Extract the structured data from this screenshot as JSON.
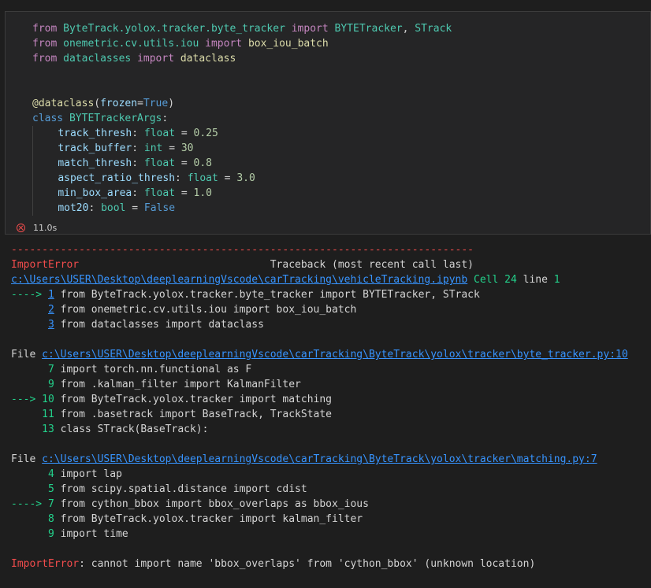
{
  "cell": {
    "code_lines": [
      [
        [
          "kw",
          "from"
        ],
        [
          "plain",
          " "
        ],
        [
          "mod",
          "ByteTrack.yolox.tracker.byte_tracker"
        ],
        [
          "plain",
          " "
        ],
        [
          "kw",
          "import"
        ],
        [
          "plain",
          " "
        ],
        [
          "cls",
          "BYTETracker"
        ],
        [
          "plain",
          ", "
        ],
        [
          "cls",
          "STrack"
        ]
      ],
      [
        [
          "kw",
          "from"
        ],
        [
          "plain",
          " "
        ],
        [
          "mod",
          "onemetric.cv.utils.iou"
        ],
        [
          "plain",
          " "
        ],
        [
          "kw",
          "import"
        ],
        [
          "plain",
          " "
        ],
        [
          "fn",
          "box_iou_batch"
        ]
      ],
      [
        [
          "kw",
          "from"
        ],
        [
          "plain",
          " "
        ],
        [
          "mod",
          "dataclasses"
        ],
        [
          "plain",
          " "
        ],
        [
          "kw",
          "import"
        ],
        [
          "plain",
          " "
        ],
        [
          "fn",
          "dataclass"
        ]
      ],
      [],
      [],
      [
        [
          "fn",
          "@dataclass"
        ],
        [
          "plain",
          "("
        ],
        [
          "name",
          "frozen"
        ],
        [
          "plain",
          "="
        ],
        [
          "kw2",
          "True"
        ],
        [
          "plain",
          ")"
        ]
      ],
      [
        [
          "kw2",
          "class"
        ],
        [
          "plain",
          " "
        ],
        [
          "cls",
          "BYTETrackerArgs"
        ],
        [
          "plain",
          ":"
        ]
      ],
      [
        [
          "indent",
          "    "
        ],
        [
          "name",
          "track_thresh"
        ],
        [
          "plain",
          ": "
        ],
        [
          "cls",
          "float"
        ],
        [
          "plain",
          " = "
        ],
        [
          "num",
          "0.25"
        ]
      ],
      [
        [
          "indent",
          "    "
        ],
        [
          "name",
          "track_buffer"
        ],
        [
          "plain",
          ": "
        ],
        [
          "cls",
          "int"
        ],
        [
          "plain",
          " = "
        ],
        [
          "num",
          "30"
        ]
      ],
      [
        [
          "indent",
          "    "
        ],
        [
          "name",
          "match_thresh"
        ],
        [
          "plain",
          ": "
        ],
        [
          "cls",
          "float"
        ],
        [
          "plain",
          " = "
        ],
        [
          "num",
          "0.8"
        ]
      ],
      [
        [
          "indent",
          "    "
        ],
        [
          "name",
          "aspect_ratio_thresh"
        ],
        [
          "plain",
          ": "
        ],
        [
          "cls",
          "float"
        ],
        [
          "plain",
          " = "
        ],
        [
          "num",
          "3.0"
        ]
      ],
      [
        [
          "indent",
          "    "
        ],
        [
          "name",
          "min_box_area"
        ],
        [
          "plain",
          ": "
        ],
        [
          "cls",
          "float"
        ],
        [
          "plain",
          " = "
        ],
        [
          "num",
          "1.0"
        ]
      ],
      [
        [
          "indent",
          "    "
        ],
        [
          "name",
          "mot20"
        ],
        [
          "plain",
          ": "
        ],
        [
          "cls",
          "bool"
        ],
        [
          "plain",
          " = "
        ],
        [
          "kw2",
          "False"
        ]
      ]
    ],
    "exec_time": "11.0s"
  },
  "output": {
    "lines": [
      [
        [
          "red",
          "---------------------------------------------------------------------------"
        ]
      ],
      [
        [
          "red",
          "ImportError"
        ],
        [
          "plain",
          "                               Traceback (most recent call last)"
        ]
      ],
      [
        [
          "link",
          "c:\\Users\\USER\\Desktop\\deeplearningVscode\\carTracking\\vehicleTracking.ipynb"
        ],
        [
          "plain",
          " "
        ],
        [
          "green",
          "Cell 24"
        ],
        [
          "plain",
          " line "
        ],
        [
          "green",
          "1"
        ]
      ],
      [
        [
          "green",
          "----> "
        ],
        [
          "link",
          "1"
        ],
        [
          "plain",
          " from ByteTrack.yolox.tracker.byte_tracker import BYTETracker, STrack"
        ]
      ],
      [
        [
          "plain",
          "      "
        ],
        [
          "link",
          "2"
        ],
        [
          "plain",
          " from onemetric.cv.utils.iou import box_iou_batch"
        ]
      ],
      [
        [
          "plain",
          "      "
        ],
        [
          "link",
          "3"
        ],
        [
          "plain",
          " from dataclasses import dataclass"
        ]
      ],
      [],
      [
        [
          "plain",
          "File "
        ],
        [
          "link",
          "c:\\Users\\USER\\Desktop\\deeplearningVscode\\carTracking\\ByteTrack\\yolox\\tracker\\byte_tracker.py:10"
        ]
      ],
      [
        [
          "plain",
          "      "
        ],
        [
          "green",
          "7"
        ],
        [
          "plain",
          " import torch.nn.functional as F"
        ]
      ],
      [
        [
          "plain",
          "      "
        ],
        [
          "green",
          "9"
        ],
        [
          "plain",
          " from .kalman_filter import KalmanFilter"
        ]
      ],
      [
        [
          "green",
          "---> 10"
        ],
        [
          "plain",
          " from ByteTrack.yolox.tracker import matching"
        ]
      ],
      [
        [
          "plain",
          "     "
        ],
        [
          "green",
          "11"
        ],
        [
          "plain",
          " from .basetrack import BaseTrack, TrackState"
        ]
      ],
      [
        [
          "plain",
          "     "
        ],
        [
          "green",
          "13"
        ],
        [
          "plain",
          " class STrack(BaseTrack):"
        ]
      ],
      [],
      [
        [
          "plain",
          "File "
        ],
        [
          "link",
          "c:\\Users\\USER\\Desktop\\deeplearningVscode\\carTracking\\ByteTrack\\yolox\\tracker\\matching.py:7"
        ]
      ],
      [
        [
          "plain",
          "      "
        ],
        [
          "green",
          "4"
        ],
        [
          "plain",
          " import lap"
        ]
      ],
      [
        [
          "plain",
          "      "
        ],
        [
          "green",
          "5"
        ],
        [
          "plain",
          " from scipy.spatial.distance import cdist"
        ]
      ],
      [
        [
          "green",
          "----> 7"
        ],
        [
          "plain",
          " from cython_bbox import bbox_overlaps as bbox_ious"
        ]
      ],
      [
        [
          "plain",
          "      "
        ],
        [
          "green",
          "8"
        ],
        [
          "plain",
          " from ByteTrack.yolox.tracker import kalman_filter"
        ]
      ],
      [
        [
          "plain",
          "      "
        ],
        [
          "green",
          "9"
        ],
        [
          "plain",
          " import time"
        ]
      ],
      [],
      [
        [
          "red",
          "ImportError"
        ],
        [
          "plain",
          ": cannot import name 'bbox_overlaps' from 'cython_bbox' (unknown location)"
        ]
      ]
    ]
  },
  "colors": {
    "error_red": "#f14c4c",
    "arrow_green": "#23d18b",
    "link_blue": "#3794ff",
    "background": "#1e1e1e"
  }
}
